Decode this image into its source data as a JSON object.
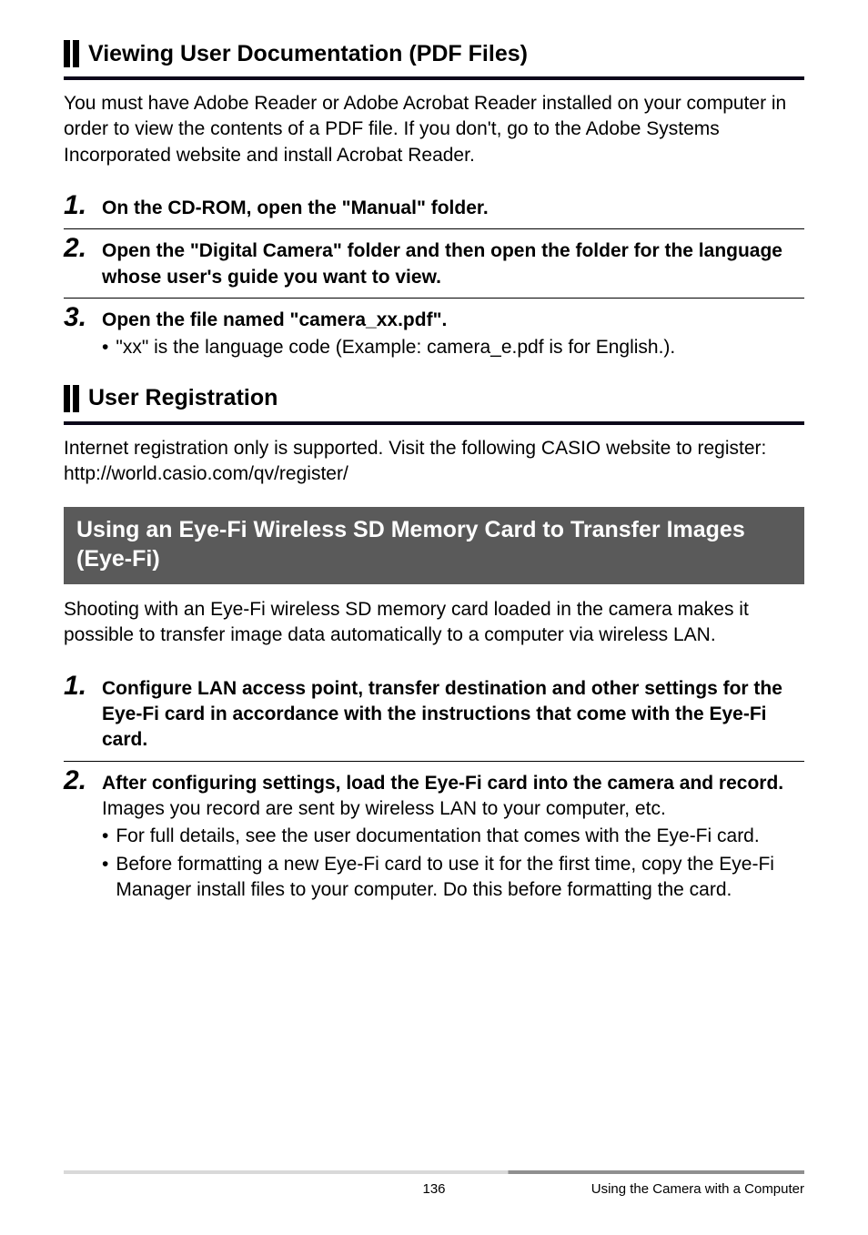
{
  "sections": {
    "viewing": {
      "heading": "Viewing User Documentation (PDF Files)",
      "intro": "You must have Adobe Reader or Adobe Acrobat Reader installed on your computer in order to view the contents of a PDF file. If you don't, go to the Adobe Systems Incorporated website and install Acrobat Reader.",
      "steps": [
        {
          "num": "1",
          "title": "On the CD-ROM, open the \"Manual\" folder."
        },
        {
          "num": "2",
          "title": "Open the \"Digital Camera\" folder and then open the folder for the language whose user's guide you want to view."
        },
        {
          "num": "3",
          "title": "Open the file named \"camera_xx.pdf\".",
          "bullet": "\"xx\" is the language code (Example: camera_e.pdf is for English.)."
        }
      ]
    },
    "userReg": {
      "heading": "User Registration",
      "intro_line1": "Internet registration only is supported. Visit the following CASIO website to register:",
      "intro_line2": "http://world.casio.com/qv/register/"
    },
    "eyefi": {
      "heading": "Using an Eye-Fi Wireless SD Memory Card to Transfer Images (Eye-Fi)",
      "intro": "Shooting with an Eye-Fi wireless SD memory card loaded in the camera makes it possible to transfer image data automatically to a computer via wireless LAN.",
      "steps": [
        {
          "num": "1",
          "title": "Configure LAN access point, transfer destination and other settings for the Eye-Fi card in accordance with the instructions that come with the Eye-Fi card."
        },
        {
          "num": "2",
          "title": "After configuring settings, load the Eye-Fi card into the camera and record.",
          "note": "Images you record are sent by wireless LAN to your computer, etc.",
          "bullets": [
            "For full details, see the user documentation that comes with the Eye-Fi card.",
            "Before formatting a new Eye-Fi card to use it for the first time, copy the Eye-Fi Manager install files to your computer. Do this before formatting the card."
          ]
        }
      ]
    }
  },
  "footer": {
    "page": "136",
    "section": "Using the Camera with a Computer"
  },
  "bullet_glyph": "•"
}
